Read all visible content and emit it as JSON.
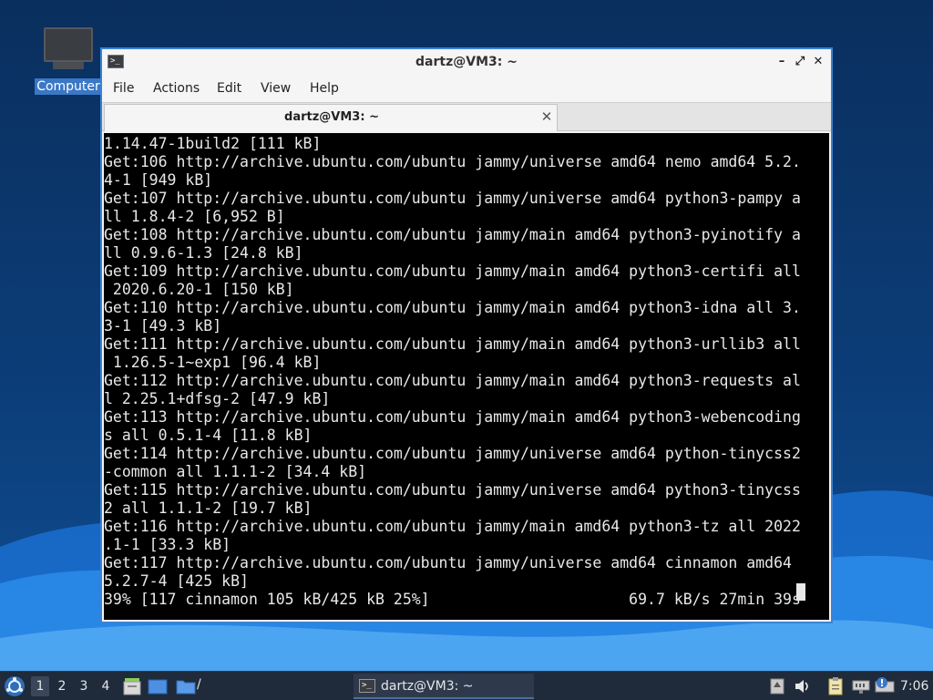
{
  "desktop": {
    "icon_label": "Computer"
  },
  "window": {
    "title": "dartz@VM3: ~",
    "controls": {
      "minimize": "–",
      "maximize": "⤢",
      "close": "✕"
    },
    "menu": [
      "File",
      "Actions",
      "Edit",
      "View",
      "Help"
    ],
    "tab": {
      "title": "dartz@VM3: ~",
      "close": "✕"
    }
  },
  "terminal": {
    "lines": [
      "1.14.47-1build2 [111 kB]",
      "Get:106 http://archive.ubuntu.com/ubuntu jammy/universe amd64 nemo amd64 5.2.",
      "4-1 [949 kB]",
      "Get:107 http://archive.ubuntu.com/ubuntu jammy/universe amd64 python3-pampy a",
      "ll 1.8.4-2 [6,952 B]",
      "Get:108 http://archive.ubuntu.com/ubuntu jammy/main amd64 python3-pyinotify a",
      "ll 0.9.6-1.3 [24.8 kB]",
      "Get:109 http://archive.ubuntu.com/ubuntu jammy/main amd64 python3-certifi all",
      " 2020.6.20-1 [150 kB]",
      "Get:110 http://archive.ubuntu.com/ubuntu jammy/main amd64 python3-idna all 3.",
      "3-1 [49.3 kB]",
      "Get:111 http://archive.ubuntu.com/ubuntu jammy/main amd64 python3-urllib3 all",
      " 1.26.5-1~exp1 [96.4 kB]",
      "Get:112 http://archive.ubuntu.com/ubuntu jammy/main amd64 python3-requests al",
      "l 2.25.1+dfsg-2 [47.9 kB]",
      "Get:113 http://archive.ubuntu.com/ubuntu jammy/main amd64 python3-webencoding",
      "s all 0.5.1-4 [11.8 kB]",
      "Get:114 http://archive.ubuntu.com/ubuntu jammy/universe amd64 python-tinycss2",
      "-common all 1.1.1-2 [34.4 kB]",
      "Get:115 http://archive.ubuntu.com/ubuntu jammy/universe amd64 python3-tinycss",
      "2 all 1.1.1-2 [19.7 kB]",
      "Get:116 http://archive.ubuntu.com/ubuntu jammy/main amd64 python3-tz all 2022",
      ".1-1 [33.3 kB]",
      "Get:117 http://archive.ubuntu.com/ubuntu jammy/universe amd64 cinnamon amd64",
      "5.2.7-4 [425 kB]",
      "39% [117 cinnamon 105 kB/425 kB 25%]                      69.7 kB/s 27min 39s"
    ]
  },
  "taskbar": {
    "workspaces": [
      "1",
      "2",
      "3",
      "4"
    ],
    "active_workspace": "1",
    "launcher_suffix": "/",
    "task_label": "dartz@VM3: ~",
    "clock": "7:06"
  },
  "colors": {
    "window_border": "#3b82d6",
    "terminal_bg": "#000000",
    "terminal_fg": "#e8e8e8",
    "taskbar_bg": "#1f2a3a",
    "desktop_icon_highlight": "#3a78c6"
  }
}
